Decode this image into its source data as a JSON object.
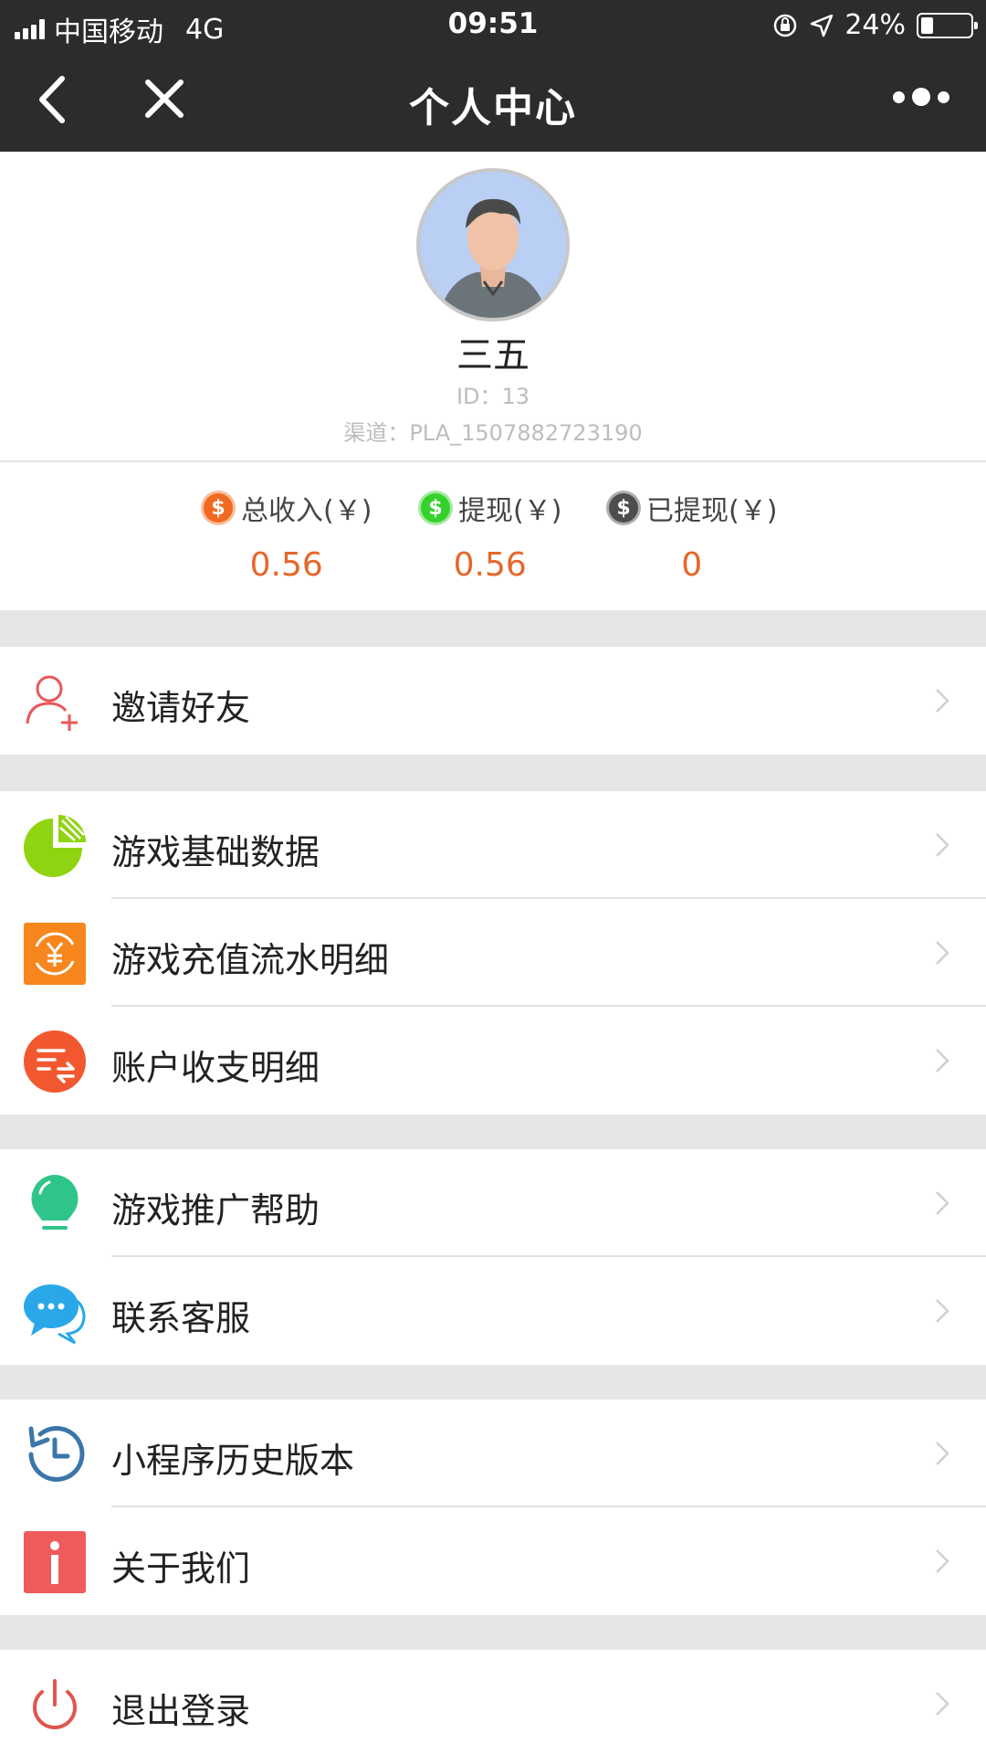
{
  "status_bar": {
    "carrier": "中国移动",
    "network": "4G",
    "time": "09:51",
    "battery": "24%"
  },
  "nav": {
    "title": "个人中心"
  },
  "profile": {
    "name": "三五",
    "id_text": "ID：13",
    "channel_text": "渠道：PLA_1507882723190"
  },
  "stats": [
    {
      "label": "总收入(￥)",
      "value": "0.56",
      "icon_color": "#f26a22",
      "icon": "coin-icon"
    },
    {
      "label": "提现(￥)",
      "value": "0.56",
      "icon_color": "#36d12c",
      "icon": "coin-icon"
    },
    {
      "label": "已提现(￥)",
      "value": "0",
      "icon_color": "#4d4d4d",
      "icon": "coin-icon"
    }
  ],
  "menu": {
    "invite": "邀请好友",
    "game_data": "游戏基础数据",
    "recharge_flow": "游戏充值流水明细",
    "account_detail": "账户收支明细",
    "promo_help": "游戏推广帮助",
    "contact_service": "联系客服",
    "history_version": "小程序历史版本",
    "about_us": "关于我们",
    "logout": "退出登录"
  },
  "colors": {
    "topbar": "#2c2c2c",
    "value_accent": "#e5672a",
    "section_gap": "#e6e6e6"
  }
}
